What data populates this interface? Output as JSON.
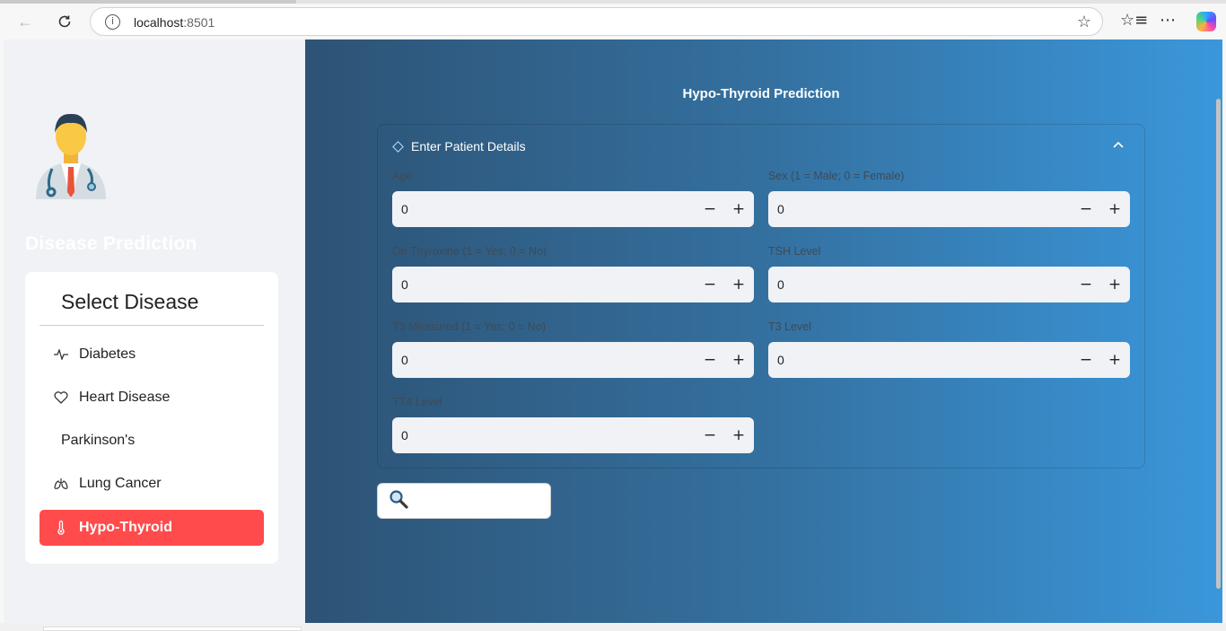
{
  "browser": {
    "url_host": "localhost",
    "url_port": ":8501"
  },
  "sidebar": {
    "app_title": "Disease Prediction",
    "menu_title": "Select Disease",
    "items": [
      {
        "label": "Diabetes",
        "icon": "activity-icon"
      },
      {
        "label": "Heart Disease",
        "icon": "heart-icon"
      },
      {
        "label": "Parkinson's",
        "icon": ""
      },
      {
        "label": "Lung Cancer",
        "icon": "lungs-icon"
      },
      {
        "label": "Hypo-Thyroid",
        "icon": "thermometer-icon",
        "active": true
      }
    ],
    "active_color": "#ff4b4b"
  },
  "main": {
    "title": "Hypo-Thyroid Prediction",
    "expander_label": "Enter Patient Details",
    "fields": [
      {
        "label": "Age",
        "value": "0"
      },
      {
        "label": "Sex (1 = Male; 0 = Female)",
        "value": "0"
      },
      {
        "label": "On Thyroxine (1 = Yes; 0 = No)",
        "value": "0"
      },
      {
        "label": "TSH Level",
        "value": "0"
      },
      {
        "label": "T3 Measured (1 = Yes; 0 = No)",
        "value": "0"
      },
      {
        "label": "T3 Level",
        "value": "0"
      },
      {
        "label": "TT4 Level",
        "value": "0"
      }
    ],
    "predict_button_icon": "magnifier-icon",
    "gradient_colors": [
      "#2d5375",
      "#3a97db"
    ]
  }
}
